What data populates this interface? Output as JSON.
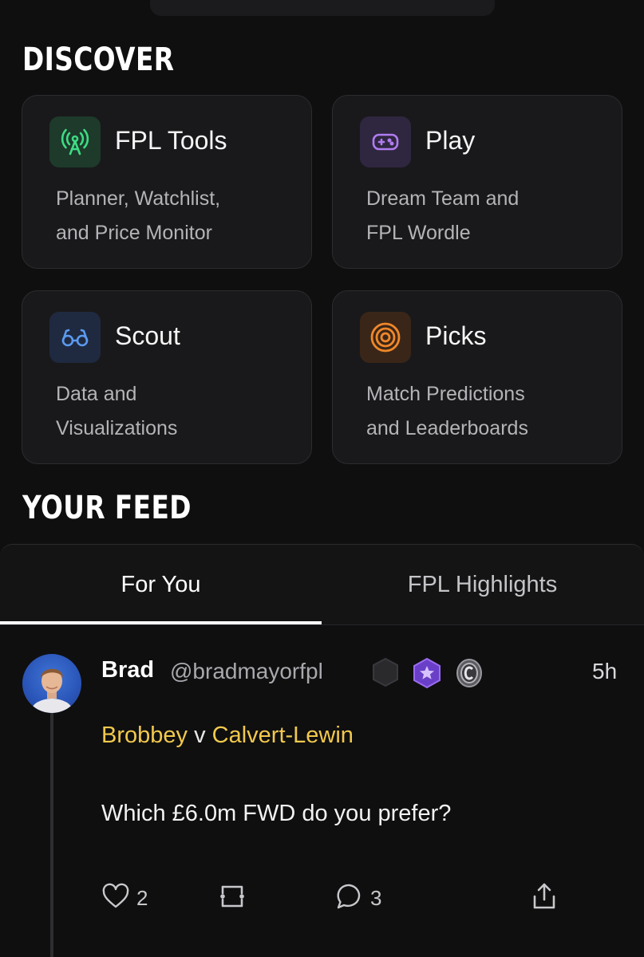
{
  "discover": {
    "title": "DISCOVER",
    "cards": [
      {
        "title": "FPL Tools",
        "desc1": "Planner, Watchlist,",
        "desc2": "and Price Monitor",
        "icon": "broadcast-tower-icon",
        "accent": "#3ddc84",
        "iconBg": "#1e3a2b"
      },
      {
        "title": "Play",
        "desc1": "Dream Team and",
        "desc2": "FPL Wordle",
        "icon": "gamepad-icon",
        "accent": "#b07cf0",
        "iconBg": "#2f2640"
      },
      {
        "title": "Scout",
        "desc1": "Data and",
        "desc2": "Visualizations",
        "icon": "glasses-icon",
        "accent": "#5b9bf0",
        "iconBg": "#1f2a40"
      },
      {
        "title": "Picks",
        "desc1": "Match Predictions",
        "desc2": "and Leaderboards",
        "icon": "target-icon",
        "accent": "#f0882a",
        "iconBg": "#3a2618"
      }
    ]
  },
  "feed": {
    "title": "YOUR FEED",
    "tabs": [
      {
        "label": "For You",
        "active": true
      },
      {
        "label": "FPL Highlights",
        "active": false
      }
    ]
  },
  "post": {
    "name": "Brad",
    "handle": "@bradmayorfpl",
    "time": "5h",
    "mention1": "Brobbey",
    "connector": "v",
    "mention2": "Calvert-Lewin",
    "body": "Which £6.0m FWD do you prefer?",
    "likes": "2",
    "comments": "3"
  }
}
